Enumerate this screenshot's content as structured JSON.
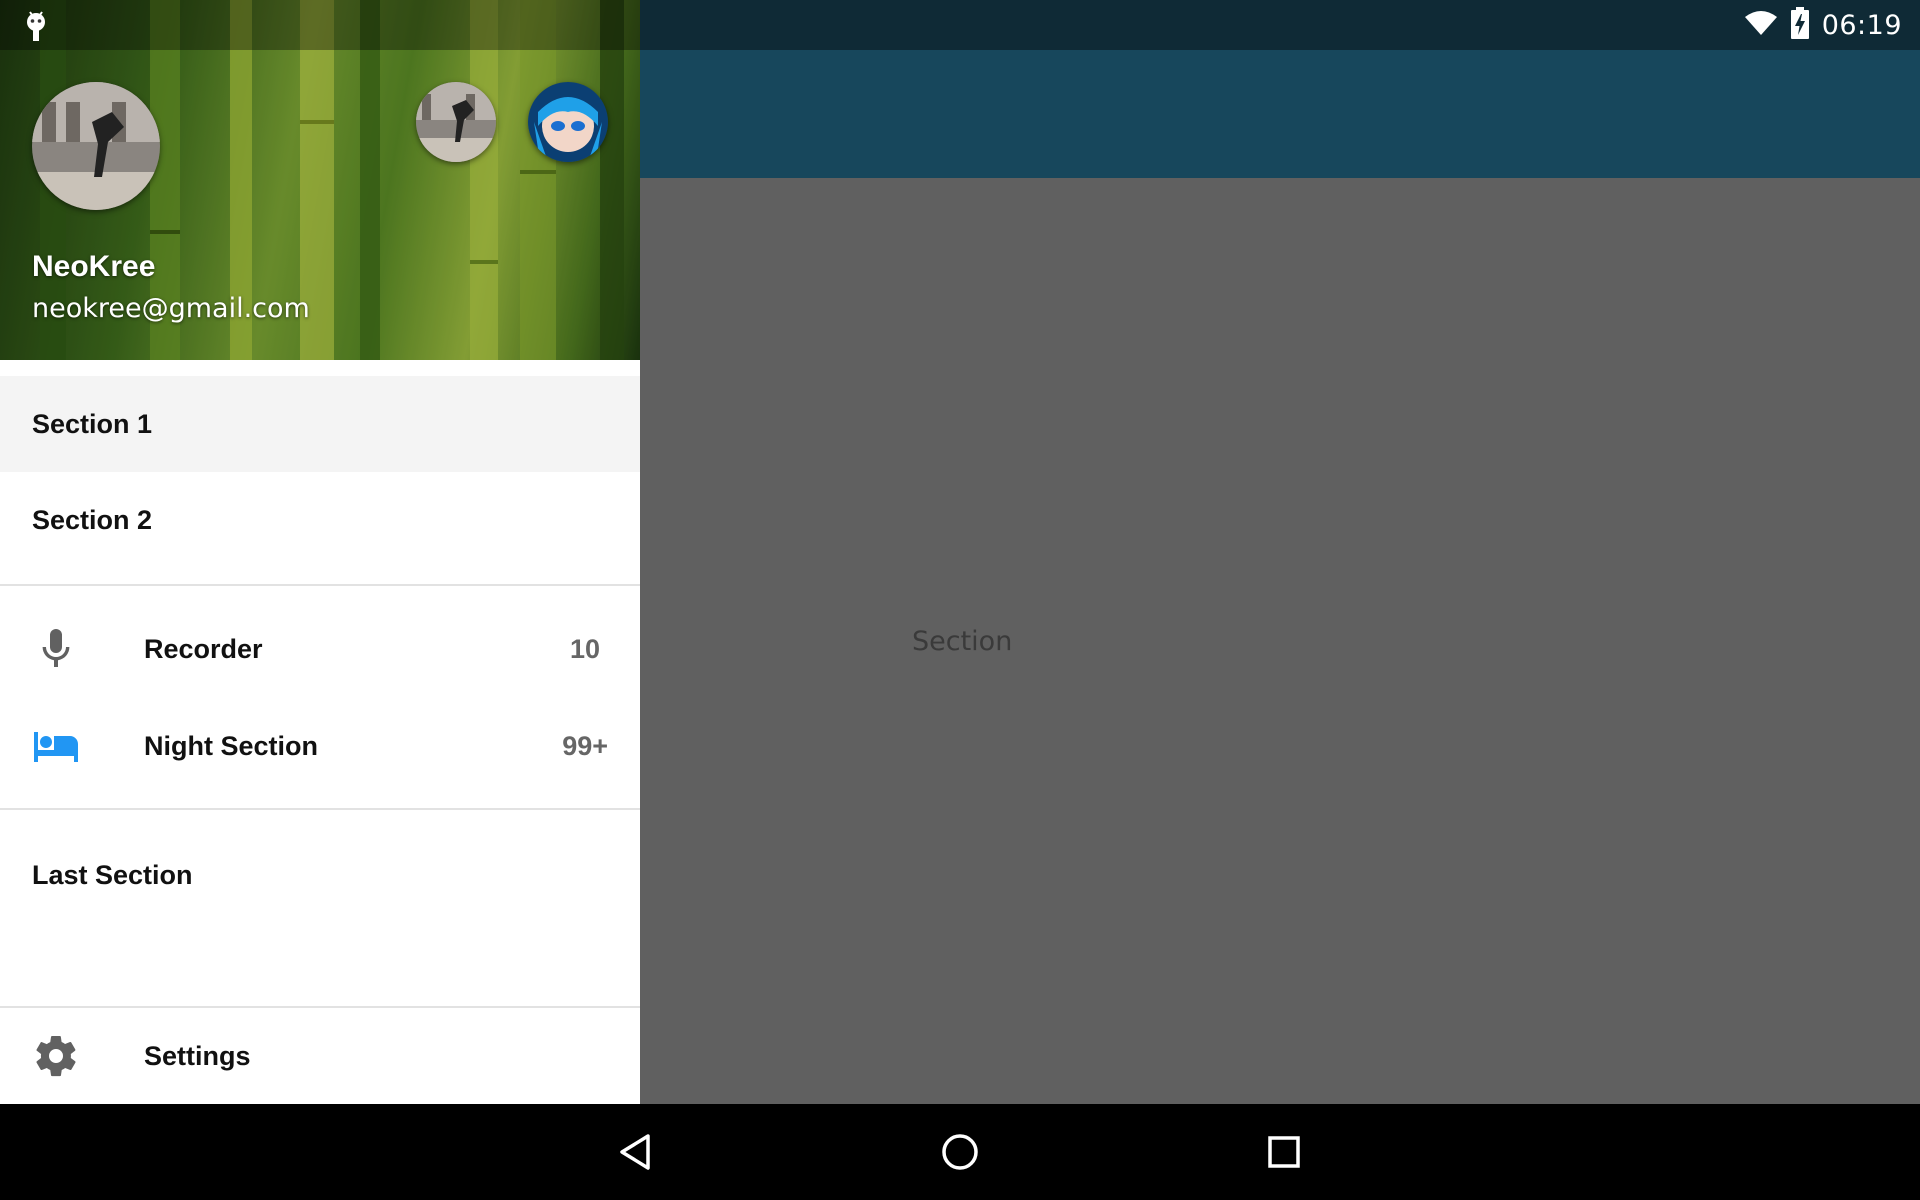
{
  "status_bar": {
    "time": "06:19",
    "icons": [
      "android-icon",
      "wifi-icon",
      "battery-charging-icon"
    ]
  },
  "drawer": {
    "header": {
      "user_name": "NeoKree",
      "user_email": "neokree@gmail.com",
      "avatars": [
        "avatar-main",
        "avatar-account-2",
        "avatar-account-3"
      ]
    },
    "sections": [
      {
        "label": "Section 1",
        "selected": true
      },
      {
        "label": "Section 2",
        "selected": false
      }
    ],
    "icon_sections": [
      {
        "label": "Recorder",
        "count": "10",
        "icon": "microphone-icon",
        "icon_color": "#616161"
      },
      {
        "label": "Night Section",
        "count": "99+",
        "icon": "bed-icon",
        "icon_color": "#2196f3"
      }
    ],
    "last_section": {
      "label": "Last Section"
    },
    "bottom": {
      "label": "Settings",
      "icon": "gear-icon"
    }
  },
  "content": {
    "text": "Section"
  },
  "colors": {
    "app_bar": "#17475c",
    "status_bar": "#0f2a36",
    "content_bg": "#606060",
    "selected_bg": "#f4f4f4",
    "accent_blue": "#2196f3"
  },
  "nav_bar": {
    "buttons": [
      "back-icon",
      "home-icon",
      "recents-icon"
    ]
  }
}
